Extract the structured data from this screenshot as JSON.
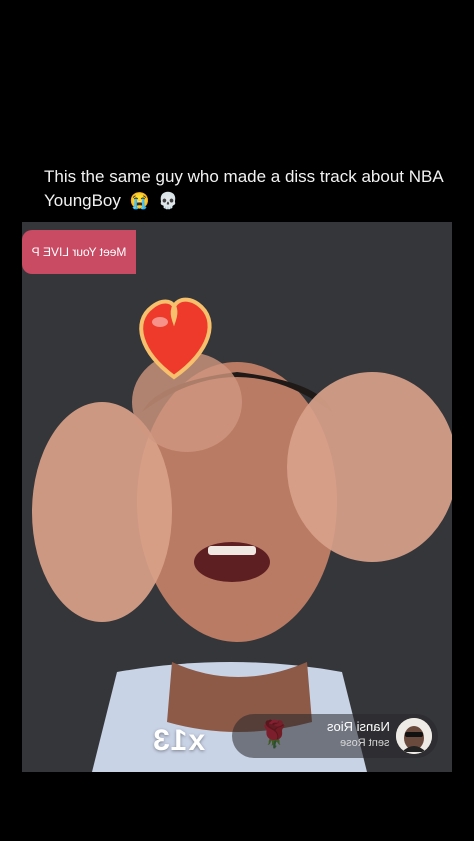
{
  "post": {
    "caption": "This the same guy who made a diss track about NBA YoungBoy",
    "caption_emojis": [
      "😭",
      "💀"
    ]
  },
  "video": {
    "promo_banner_text": "Meet Your LIVE P",
    "gift_notification": {
      "sender_name": "Nansi Rios",
      "action_text": "sent Rose",
      "combo_count": "x13",
      "gift_icon": "rose-icon"
    },
    "overlay_icon": "heart-icon"
  }
}
